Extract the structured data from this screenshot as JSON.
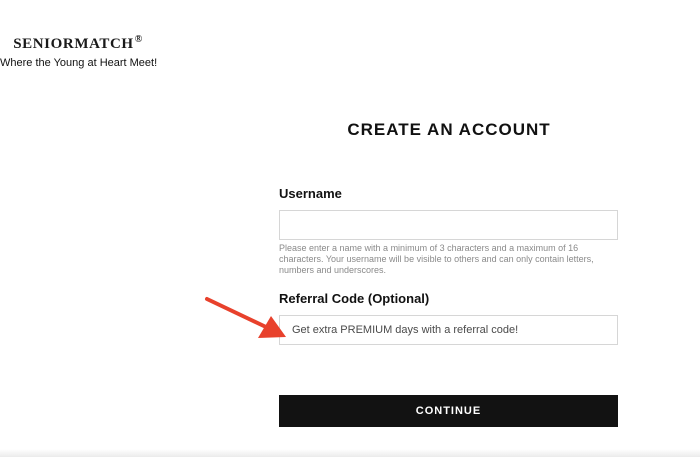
{
  "brand": {
    "name": "SENIORMATCH",
    "registered_mark": "®",
    "tagline": "Where the Young at Heart Meet!"
  },
  "form": {
    "title": "CREATE AN ACCOUNT",
    "username": {
      "label": "Username",
      "value": "",
      "placeholder": "",
      "help_text": "Please enter a name with a minimum of 3 characters and a maximum of 16 characters. Your username will be visible to others and can only contain letters, numbers and underscores."
    },
    "referral": {
      "label": "Referral Code (Optional)",
      "value": "",
      "placeholder": "Get extra PREMIUM days with a referral code!"
    },
    "continue_label": "CONTINUE"
  },
  "colors": {
    "annotation_arrow": "#e8412c",
    "button_background": "#121212",
    "input_border": "#d6d6d6"
  },
  "icons": {
    "annotation": "red-arrow-icon"
  }
}
